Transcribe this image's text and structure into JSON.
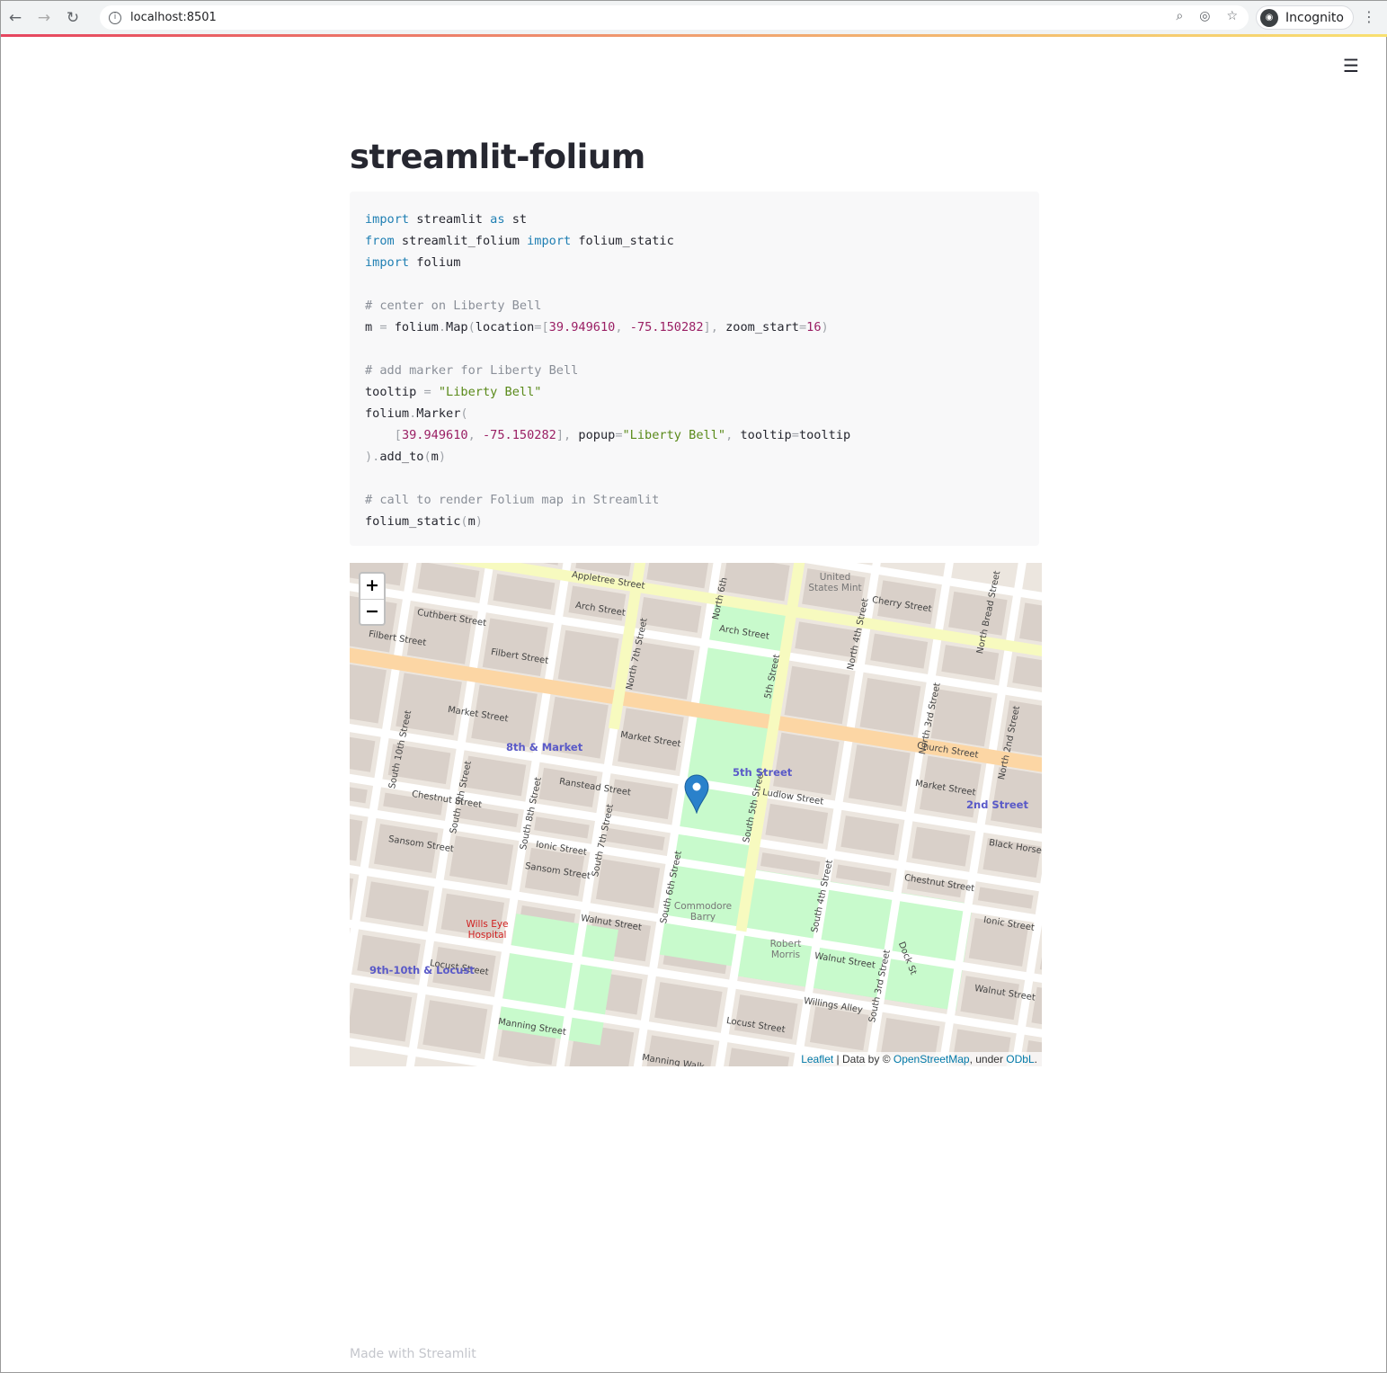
{
  "browser": {
    "url": "localhost:8501",
    "profile": "Incognito"
  },
  "page": {
    "title": "streamlit-folium",
    "footer": "Made with Streamlit"
  },
  "code_lines": [
    [
      [
        "k",
        "import"
      ],
      [
        "t",
        " streamlit "
      ],
      [
        "k",
        "as"
      ],
      [
        "t",
        " st"
      ]
    ],
    [
      [
        "k",
        "from"
      ],
      [
        "t",
        " streamlit_folium "
      ],
      [
        "k",
        "import"
      ],
      [
        "t",
        " folium_static"
      ]
    ],
    [
      [
        "k",
        "import"
      ],
      [
        "t",
        " folium"
      ]
    ],
    [],
    [
      [
        "c",
        "# center on Liberty Bell"
      ]
    ],
    [
      [
        "t",
        "m "
      ],
      [
        "p",
        "="
      ],
      [
        "t",
        " folium"
      ],
      [
        "p",
        "."
      ],
      [
        "t",
        "Map"
      ],
      [
        "p",
        "("
      ],
      [
        "t",
        "location"
      ],
      [
        "p",
        "=["
      ],
      [
        "n",
        "39.949610"
      ],
      [
        "p",
        ", "
      ],
      [
        "n",
        "-75.150282"
      ],
      [
        "p",
        "], "
      ],
      [
        "t",
        "zoom_start"
      ],
      [
        "p",
        "="
      ],
      [
        "n",
        "16"
      ],
      [
        "p",
        ")"
      ]
    ],
    [],
    [
      [
        "c",
        "# add marker for Liberty Bell"
      ]
    ],
    [
      [
        "t",
        "tooltip "
      ],
      [
        "p",
        "="
      ],
      [
        "t",
        " "
      ],
      [
        "s",
        "\"Liberty Bell\""
      ]
    ],
    [
      [
        "t",
        "folium"
      ],
      [
        "p",
        "."
      ],
      [
        "t",
        "Marker"
      ],
      [
        "p",
        "("
      ]
    ],
    [
      [
        "t",
        "    "
      ],
      [
        "p",
        "["
      ],
      [
        "n",
        "39.949610"
      ],
      [
        "p",
        ", "
      ],
      [
        "n",
        "-75.150282"
      ],
      [
        "p",
        "], "
      ],
      [
        "t",
        "popup"
      ],
      [
        "p",
        "="
      ],
      [
        "s",
        "\"Liberty Bell\""
      ],
      [
        "p",
        ", "
      ],
      [
        "t",
        "tooltip"
      ],
      [
        "p",
        "="
      ],
      [
        "t",
        "tooltip"
      ]
    ],
    [
      [
        "p",
        ")."
      ],
      [
        "t",
        "add_to"
      ],
      [
        "p",
        "("
      ],
      [
        "t",
        "m"
      ],
      [
        "p",
        ")"
      ]
    ],
    [],
    [
      [
        "c",
        "# call to render Folium map in Streamlit"
      ]
    ],
    [
      [
        "t",
        "folium_static"
      ],
      [
        "p",
        "("
      ],
      [
        "t",
        "m"
      ],
      [
        "p",
        ")"
      ]
    ]
  ],
  "map": {
    "zoom_in": "+",
    "zoom_out": "−",
    "attribution": {
      "leaflet": "Leaflet",
      "sep": " | Data by © ",
      "osm": "OpenStreetMap",
      "under": ", under ",
      "odbl": "ODbL",
      "end": "."
    },
    "streets": [
      "Appletree Street",
      "Arch Street",
      "Arch Street",
      "Cuthbert Street",
      "Filbert Street",
      "Filbert Street",
      "Market Street",
      "Market Street",
      "Market Street",
      "Chestnut Street",
      "Sansom Street",
      "Sansom Street",
      "Ranstead Street",
      "Ludlow Street",
      "Ionic Street",
      "Walnut Street",
      "Walnut Street",
      "Locust Street",
      "Manning Street",
      "Cherry Street",
      "Church Street",
      "Chestnut Street",
      "Black Horse",
      "Willings Alley",
      "Locust Street",
      "Manning Walk",
      "North 7th Street",
      "5th Street",
      "North 4th Street",
      "North 3rd Street",
      "South 9th Street",
      "South 8th Street",
      "South 7th Street",
      "South 6th Street",
      "South 5th Street",
      "South 4th Street",
      "South 3rd Street",
      "Dock St",
      "Walnut Street",
      "Ionic Street",
      "North 6th",
      "North 2nd Street",
      "South 10th Street",
      "North Bread Street"
    ],
    "stations": [
      "8th & Market",
      "5th Street",
      "2nd Street",
      "9th-10th & Locust"
    ],
    "pois": [
      "United States Mint",
      "Commodore Barry",
      "Robert Morris",
      "Wills Eye Hospital"
    ],
    "marker": {
      "tooltip": "Liberty Bell",
      "lat": 39.94961,
      "lon": -75.150282,
      "color": "#2a81cb"
    },
    "colors": {
      "land": "#ece6df",
      "park": "#c8facc",
      "primary": "#fcd6a4",
      "secondary": "#f7fabf",
      "building": "#d9d0c9"
    }
  }
}
